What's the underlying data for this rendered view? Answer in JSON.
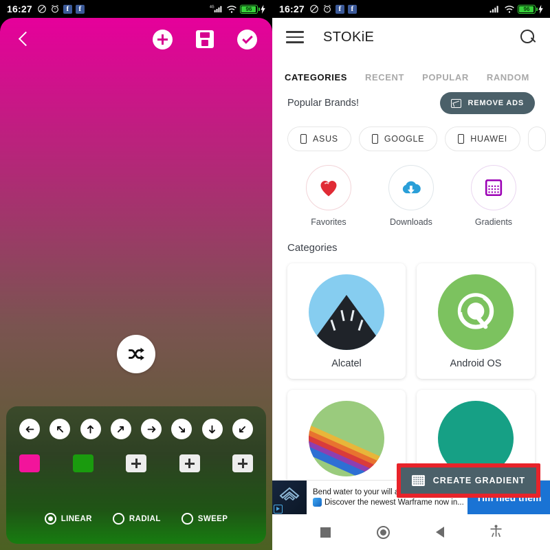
{
  "status_bar": {
    "time": "16:27",
    "battery_level": "96",
    "icons": [
      "mute-icon",
      "alarm-icon",
      "facebook-icon",
      "facebook-icon",
      "signal-4g-icon",
      "wifi-icon",
      "battery-icon",
      "charging-bolt-icon"
    ]
  },
  "left_phone": {
    "name": "gradient-editor",
    "toolbar": {
      "back_label": "Back",
      "add_label": "Add color",
      "save_label": "Save",
      "confirm_label": "Apply"
    },
    "shuffle_label": "Shuffle",
    "gradient": {
      "start_color": "#e6009b",
      "mid_color": "#7a5450",
      "end_color": "#4b6122",
      "angle": "180deg"
    },
    "directions": [
      {
        "name": "direction-left",
        "glyph": "←"
      },
      {
        "name": "direction-up-left",
        "glyph": "↖"
      },
      {
        "name": "direction-up",
        "glyph": "↑"
      },
      {
        "name": "direction-up-right",
        "glyph": "↗"
      },
      {
        "name": "direction-right",
        "glyph": "→"
      },
      {
        "name": "direction-down-right",
        "glyph": "↘"
      },
      {
        "name": "direction-down",
        "glyph": "↓"
      },
      {
        "name": "direction-down-left",
        "glyph": "↙"
      }
    ],
    "swatches": [
      {
        "label": "color-1",
        "color": "#f2149b"
      },
      {
        "label": "color-2",
        "color": "#1a9b0e"
      }
    ],
    "add_swatches": [
      "add-color-3",
      "add-color-4",
      "add-color-5"
    ],
    "gradient_types": [
      {
        "label": "LINEAR",
        "selected": true
      },
      {
        "label": "RADIAL",
        "selected": false
      },
      {
        "label": "SWEEP",
        "selected": false
      }
    ]
  },
  "right_phone": {
    "app_title": "STOKiE",
    "menu_label": "Menu",
    "search_label": "Search",
    "tabs": [
      {
        "label": "CATEGORIES",
        "active": true
      },
      {
        "label": "RECENT",
        "active": false
      },
      {
        "label": "POPULAR",
        "active": false
      },
      {
        "label": "RANDOM",
        "active": false
      }
    ],
    "brands_section": {
      "title": "Popular Brands!",
      "remove_ads_label": "REMOVE ADS",
      "chips": [
        "ASUS",
        "GOOGLE",
        "HUAWEI"
      ]
    },
    "quick_actions": [
      {
        "label": "Favorites",
        "icon": "heart-icon",
        "color": "#e02b35"
      },
      {
        "label": "Downloads",
        "icon": "cloud-download-icon",
        "color": "#2a9fd8"
      },
      {
        "label": "Gradients",
        "icon": "gradient-grid-icon",
        "color": "#9b00b5"
      }
    ],
    "categories_section": {
      "title": "Categories",
      "cards": [
        {
          "label": "Alcatel",
          "thumb": "alcatel-building-thumb"
        },
        {
          "label": "Android OS",
          "thumb": "android-q-logo-thumb"
        },
        {
          "label": "",
          "thumb": "rainbow-green-thumb"
        },
        {
          "label": "",
          "thumb": "teal-thumb"
        }
      ]
    },
    "create_gradient": {
      "label": "CREATE GRADIENT",
      "highlight_color": "#e8232a",
      "button_color": "#4b6069"
    },
    "ad": {
      "line1": "Bend water to your will as Yareli, the waverider!",
      "line2": "Discover the newest Warframe now in...",
      "cta": "Tìm hiểu thêm"
    },
    "nav_bar": [
      "recents-square-icon",
      "home-circle-icon",
      "back-triangle-icon",
      "accessibility-icon"
    ]
  }
}
